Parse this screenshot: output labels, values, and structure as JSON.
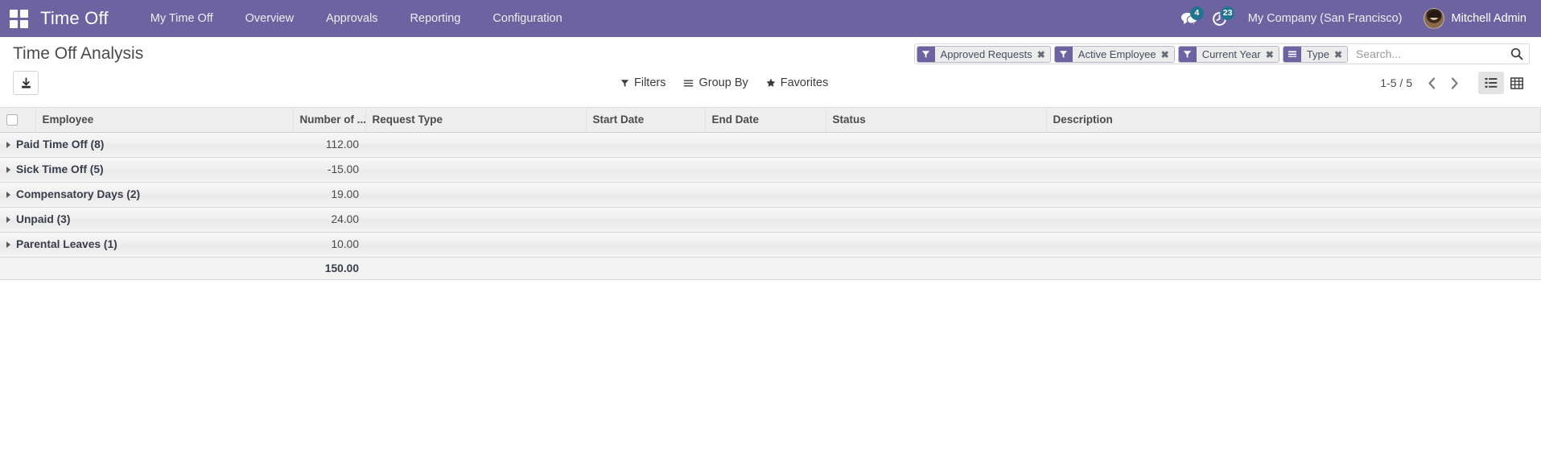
{
  "navbar": {
    "apps_icon": "apps-grid-icon",
    "brand": "Time Off",
    "menu": [
      {
        "label": "My Time Off"
      },
      {
        "label": "Overview"
      },
      {
        "label": "Approvals"
      },
      {
        "label": "Reporting"
      },
      {
        "label": "Configuration"
      }
    ],
    "messages_icon": "messages-icon",
    "messages_count": "4",
    "activity_icon": "clock-activity-icon",
    "activity_count": "23",
    "company": "My Company (San Francisco)",
    "user": "Mitchell Admin",
    "avatar_icon": "user-avatar",
    "accent": "#6c63a0",
    "badge_color": "#21748f"
  },
  "control_panel": {
    "title": "Time Off Analysis",
    "download_icon": "download-icon",
    "search": {
      "placeholder": "Search...",
      "value": "",
      "search_icon": "search-icon",
      "facets": [
        {
          "icon": "filter-funnel-icon",
          "label": "Approved Requests",
          "remove_icon": "close-x-icon"
        },
        {
          "icon": "filter-funnel-icon",
          "label": "Active Employee",
          "remove_icon": "close-x-icon"
        },
        {
          "icon": "filter-funnel-icon",
          "label": "Current Year",
          "remove_icon": "close-x-icon"
        },
        {
          "icon": "group-by-bars-icon",
          "label": "Type",
          "remove_icon": "close-x-icon"
        }
      ]
    },
    "dropdowns": [
      {
        "icon": "filter-funnel-icon",
        "label": "Filters"
      },
      {
        "icon": "group-by-hamburger-icon",
        "label": "Group By"
      },
      {
        "icon": "star-icon",
        "label": "Favorites"
      }
    ],
    "pager": {
      "range": "1-5 / 5",
      "prev_icon": "chevron-left-icon",
      "next_icon": "chevron-right-icon"
    },
    "views": [
      {
        "icon": "list-view-icon",
        "name": "list",
        "active": true
      },
      {
        "icon": "pivot-view-icon",
        "name": "pivot",
        "active": false
      }
    ]
  },
  "table": {
    "select_all_icon": "checkbox-unchecked",
    "columns": [
      {
        "label": "Employee",
        "align": "left"
      },
      {
        "label": "Number of ...",
        "align": "right"
      },
      {
        "label": "Request Type",
        "align": "left"
      },
      {
        "label": "Start Date",
        "align": "left"
      },
      {
        "label": "End Date",
        "align": "left"
      },
      {
        "label": "Status",
        "align": "left"
      },
      {
        "label": "Description",
        "align": "left"
      }
    ],
    "groups": [
      {
        "label": "Paid Time Off (8)",
        "value": "112.00"
      },
      {
        "label": "Sick Time Off (5)",
        "value": "-15.00"
      },
      {
        "label": "Compensatory Days (2)",
        "value": "19.00"
      },
      {
        "label": "Unpaid (3)",
        "value": "24.00"
      },
      {
        "label": "Parental Leaves (1)",
        "value": "10.00"
      }
    ],
    "total": "150.00"
  }
}
